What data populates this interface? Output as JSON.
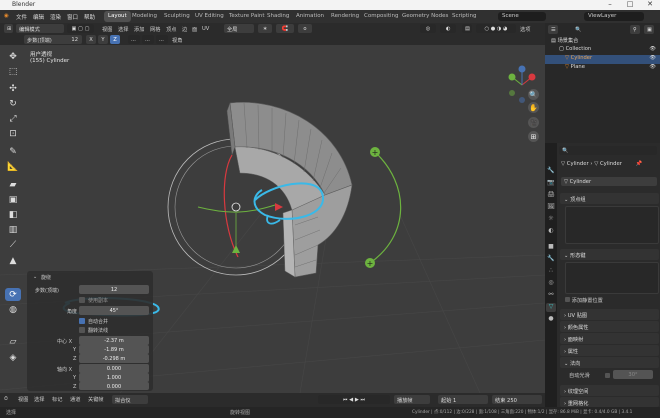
{
  "window": {
    "title": "Blender"
  },
  "menubar": {
    "menus": [
      "文件",
      "编辑",
      "渲染",
      "窗口",
      "帮助"
    ],
    "workspaces": [
      "Layout",
      "Modeling",
      "Sculpting",
      "UV Editing",
      "Texture Paint",
      "Shading",
      "Animation",
      "Rendering",
      "Compositing",
      "Geometry Nodes",
      "Scripting"
    ],
    "active_workspace": "Layout",
    "scene": "Scene",
    "view_layer": "ViewLayer"
  },
  "header": {
    "mode": "编辑模式",
    "view_menus": [
      "视图",
      "选择",
      "添加",
      "网格",
      "顶点",
      "边",
      "面",
      "UV"
    ],
    "transform_orient": "全局",
    "pivot": "∗",
    "proportional": "o",
    "options_label": "选项"
  },
  "header2": {
    "steps_label": "步数(顶端)",
    "steps_value": "12",
    "axes": [
      "X",
      "Y",
      "Z"
    ],
    "extra": [
      "...",
      "...",
      "..."
    ],
    "orient_label": "视角"
  },
  "viewport": {
    "view_name": "用户透视",
    "object_info": "(155) Cylinder",
    "accent_blue": "#4772b3",
    "gizmo_green": "#6db33f",
    "axis_red": "#d8393f"
  },
  "toolbar": {
    "tools": [
      "cursor-icon",
      "select-icon",
      "move-icon",
      "rotate-icon",
      "scale-icon",
      "transform-icon",
      "annotate-icon",
      "measure-icon",
      "extrude-icon",
      "inset-icon",
      "bevel-icon",
      "loopcut-icon",
      "knife-icon",
      "polybuild-icon",
      "spin-icon",
      "smooth-icon",
      "shear-icon",
      "rip-icon"
    ],
    "active_tool": "spin-icon"
  },
  "operator_panel": {
    "title": "旋绕",
    "steps_label": "步数(顶端)",
    "steps_value": "12",
    "dupli_label": "使用副本",
    "angle_label": "角度",
    "angle_value": "45°",
    "auto_merge_label": "自动合并",
    "flip_normals_label": "翻转法线",
    "center_label": "中心 X",
    "center_x": "-2.37 m",
    "center_y": "-1.89 m",
    "center_z": "-0.298 m",
    "axis_label": "轴向 X",
    "axis_x": "0.000",
    "axis_y": "1.000",
    "axis_z": "0.000",
    "y_label": "Y",
    "z_label": "Z"
  },
  "viewfooter": {
    "items": [
      "视图",
      "选择",
      "标记",
      "通道",
      "关键帧",
      "拟合仪"
    ],
    "playback": "播放帧",
    "start_label": "起始",
    "start_value": "1",
    "end_label": "结束",
    "end_value": "250"
  },
  "statusbar": {
    "left": "选择",
    "middle": "旋转视图",
    "right": "Cylinder | 点:0/112 | 边:0/228 | 面:1/108 | 三角面:220 | 物体:1/2 | 显存: 86.8 MiB | 显卡: 0.4/4.0 GB | 3.4.1"
  },
  "outliner": {
    "search_placeholder": "",
    "root": "场景集合",
    "items": [
      {
        "name": "Collection",
        "kind": "collection"
      },
      {
        "name": "Cylinder",
        "kind": "mesh",
        "selected": true
      },
      {
        "name": "Plane",
        "kind": "mesh"
      }
    ]
  },
  "properties": {
    "breadcrumb_obj": "Cylinder",
    "breadcrumb_data": "Cylinder",
    "data_name": "Cylinder",
    "sections": [
      "顶点组",
      "形态键",
      "添加静置位置",
      "UV 贴图",
      "颜色属性",
      "面映射",
      "属性",
      "法向",
      "纹理空间",
      "重网格化"
    ],
    "auto_smooth_label": "自动光滑",
    "auto_smooth_value": "30°"
  }
}
